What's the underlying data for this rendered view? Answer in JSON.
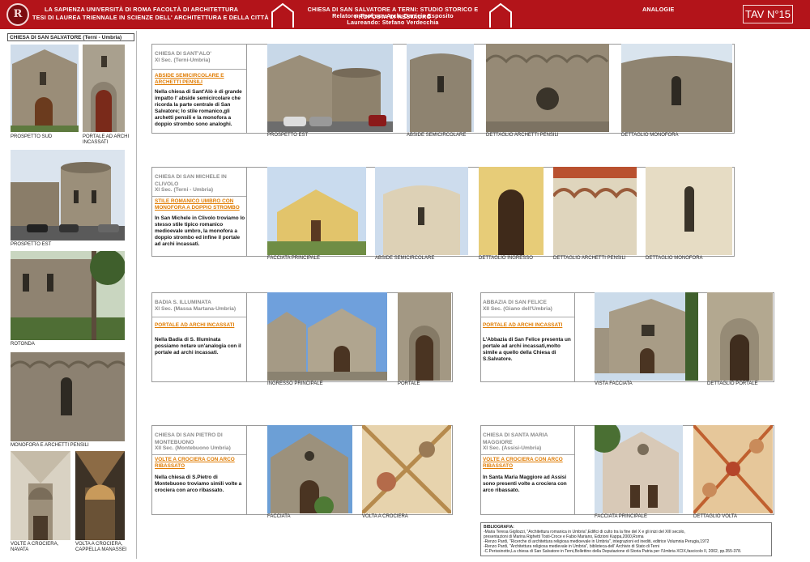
{
  "header": {
    "seal_letter": "R",
    "university": "LA SAPIENZA UNIVERSITÀ DI ROMA   FACOLTÀ DI ARCHITETTURA",
    "thesis": "TESI DI LAUREA TRIENNALE IN SCIENZE DELL' ARCHITETTURA E DELLA CITTÀ",
    "project_title": "CHIESA DI SAN SALVATORE A TERNI: STUDIO STORICO E PROPOSTA DI RESTAURO",
    "relatore": "Relatore: Prof.ssa Arch. Danieia Esposito",
    "laureando": "Laureando: Stefano Verdecchia",
    "section": "ANALOGIE",
    "tav": "TAV N°15"
  },
  "left": {
    "title": "CHIESA DI SAN SALVATORE (Terni - Umbria)",
    "captions": {
      "prospetto_sud": "PROSPETTO SUD",
      "portale": "PORTALE AD ARCHI INCASSATI",
      "prospetto_est": "PROSPETTO EST",
      "rotonda": "ROTONDA",
      "monofora": "MONOFORA E ARCHETTI PENSILI",
      "volte_navata": "VOLTE A CROCIERA, NAVATA",
      "volte_cappella": "VOLTA A CROCIERA, CAPPELLA MANASSEI"
    }
  },
  "panels": {
    "santalo": {
      "title": "CHIESA DI SANT'ALO'",
      "subtitle": "XI Sec. (Terni-Umbria)",
      "heading": "ABSIDE SEMICIRCOLARE E ARCHETTI PENSILI",
      "body": "Nella chiesa di Sant'Alò è di grande impatto l' abside semicircolare che ricorda la parte centrale di San Salvatore; lo stile romanico,gli archetti pensili e la monofora a doppio strombo sono analoghi.",
      "captions": [
        "PROSPETTO EST",
        "ABSIDE SEMICIRCOLARE",
        "DETTAGLIO ARCHETTI PENSILI",
        "DETTAGLIO MONOFORA"
      ]
    },
    "michele": {
      "title": "CHIESA DI SAN MICHELE IN CLIVOLO",
      "subtitle": "XI Sec. (Terni - Umbria)",
      "heading": "STILE ROMANICO UMBRO CON MONOFORA A DOPPIO STROMBO",
      "body": "In San Michele in Clivolo troviamo lo stesso stile tipico romanico medioevale umbro, la monofora a doppio strombo ed infine il portale ad archi incassati.",
      "captions": [
        "FACCIATA PRINCIPALE",
        "ABSIDE SEMICIRCOLARE",
        "DETTAGLIO INGRESSO",
        "DETTAGLIO ARCHETTI PENSILI",
        "DETTAGLIO MONOFORA"
      ]
    },
    "badia": {
      "title": "BADIA S. ILLUMINATA",
      "subtitle": "XI Sec. (Massa Martana-Umbria)",
      "heading": "PORTALE AD ARCHI INCASSATI",
      "body": "Nella Badia di S. Illuminata possiamo notare un'analogia con il portale ad archi incassati.",
      "captions": [
        "INGRESSO PRINCIPALE",
        "PORTALE"
      ]
    },
    "felice": {
      "title": "ABBAZIA DI SAN FELICE",
      "subtitle": "XII Sec. (Giano dell'Umbria)",
      "heading": "PORTALE AD ARCHI INCASSATI",
      "body": "L'Abbazia di San Felice presenta un portale ad archi incassati,molto simile a quello della Chiesa di S.Salvatore.",
      "captions": [
        "VISTA FACCIATA",
        "DETTAGLIO PORTALE"
      ]
    },
    "pietro": {
      "title": "CHIESA DI SAN PIETRO DI MONTEBUONO",
      "subtitle": "XII Sec. (Montebuono Umbria)",
      "heading": "VOLTE A CROCIERA CON ARCO RIBASSATO",
      "body": "Nella chiesa di S.Pietro di Montebuono troviamo simili volte a crociera con arco ribassato.",
      "captions": [
        "FACCIATA",
        "VOLTA A CROCIERA"
      ]
    },
    "maria": {
      "title": "CHIESA DI SANTA MARIA MAGGIORE",
      "subtitle": "XI Sec. (Assisi-Umbria)",
      "heading": "VOLTE A CROCIERA CON ARCO RIBASSATO",
      "body": "In Santa Maria Maggiore ad Assisi sono presenti volte a crociera con arco ribassato.",
      "captions": [
        "FACCIATA PRINCIPALE",
        "DETTAGLIO VOLTA"
      ]
    }
  },
  "bibliography": {
    "title": "BIBLIOGRAFIA:",
    "lines": [
      "-Maria Teresa Gigliozzi, \"Architettura romanica in Umbria\",Edifici di culto tra la fine del X e gli inizi del XIII secolo,",
      "  presentazioni di Marina Righetti Tosti-Croce e Fabio Mariano, Edizioni Kappa,2000,Roma",
      "-Renzo Pardi, \"Ricerche di architettura religiosa medioevale in Umbria\", integrazioni ed inediti, editrice Volumnia Perugia,1972",
      "-Renzo Pardi, \"Architettura religiosa medievale in Umbria\", biblioteca-dell' Archivio di Stato di Terni",
      "-C.Perissinotto,La chiesa di San Salvatore in Terni,Bollettino della Deputazione di Storia Patria per l'Umbria XCIX,fascicolo II, 2002, pp.355-378."
    ]
  },
  "colors": {
    "header_red": "#b3141a",
    "heading_orange": "#e07b00",
    "title_grey": "#8a8a8a",
    "stone": "#a29784",
    "sky": "#b9cfe6"
  }
}
